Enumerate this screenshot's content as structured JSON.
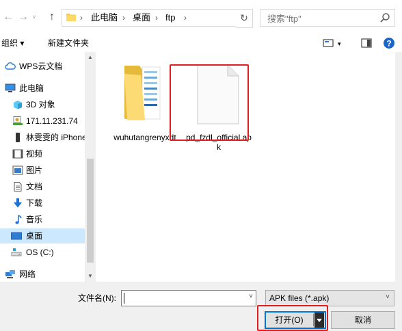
{
  "nav": {
    "back_icon": "back-arrow-icon",
    "forward_icon": "forward-arrow-icon",
    "up_icon": "up-arrow-icon"
  },
  "address": {
    "crumbs": [
      "此电脑",
      "桌面",
      "ftp"
    ],
    "refresh_icon": "refresh-icon"
  },
  "search": {
    "placeholder": "搜索\"ftp\""
  },
  "toolbar": {
    "organize_label": "组织 ▾",
    "new_folder_label": "新建文件夹"
  },
  "sidebar": {
    "items": [
      {
        "label": "WPS云文档",
        "icon": "cloud-icon"
      },
      {
        "label": "此电脑",
        "icon": "computer-icon"
      },
      {
        "label": "3D 对象",
        "icon": "3d-objects-icon"
      },
      {
        "label": "171.11.231.74",
        "icon": "network-drive-icon"
      },
      {
        "label": "林雯雯的 iPhone",
        "icon": "phone-icon"
      },
      {
        "label": "视频",
        "icon": "video-icon"
      },
      {
        "label": "图片",
        "icon": "pictures-icon"
      },
      {
        "label": "文档",
        "icon": "documents-icon"
      },
      {
        "label": "下载",
        "icon": "download-icon"
      },
      {
        "label": "音乐",
        "icon": "music-icon"
      },
      {
        "label": "桌面",
        "icon": "desktop-icon"
      },
      {
        "label": "OS (C:)",
        "icon": "drive-icon"
      },
      {
        "label": "网络",
        "icon": "network-icon"
      }
    ]
  },
  "files": [
    {
      "name": "wuhutangrenyxdt",
      "icon": "folder-icon"
    },
    {
      "name": "pd_fzdl_official.apk",
      "icon": "blank-file-icon"
    }
  ],
  "bottom": {
    "filename_label": "文件名(N):",
    "filename_value": "",
    "filetype_value": "APK files (*.apk)",
    "open_label": "打开(O)",
    "cancel_label": "取消"
  },
  "colors": {
    "selected_bg": "#cce8ff",
    "highlight_red": "#e02020",
    "accent": "#0078d7"
  }
}
